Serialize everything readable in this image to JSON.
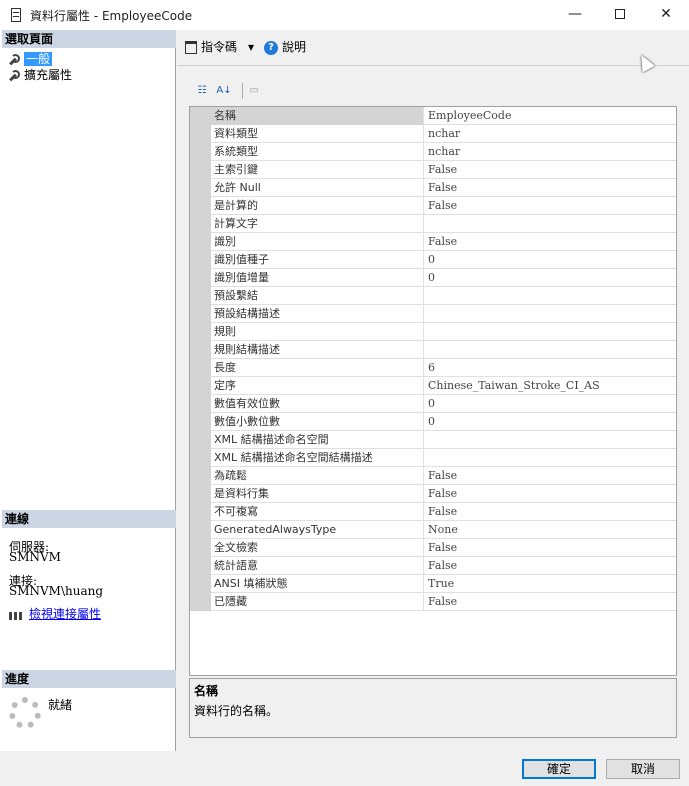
{
  "window": {
    "title": "資料行屬性 - EmployeeCode",
    "minimize": "—",
    "close": "✕"
  },
  "left": {
    "pages_header": "選取頁面",
    "pages": [
      "一般",
      "擴充屬性"
    ],
    "connection_header": "連線",
    "server_label": "伺服器:",
    "server_value": "SMNVM",
    "connection_label": "連接:",
    "connection_value": "SMNVM\\huang",
    "view_conn_link": "檢視連接屬性",
    "progress_header": "進度",
    "progress_status": "就緒"
  },
  "toolbar": {
    "script_label": "指令碼",
    "help_label": "說明",
    "dropdown_glyph": "▾"
  },
  "properties": [
    {
      "name": "名稱",
      "value": "EmployeeCode"
    },
    {
      "name": "資料類型",
      "value": "nchar"
    },
    {
      "name": "系統類型",
      "value": "nchar"
    },
    {
      "name": "主索引鍵",
      "value": "False"
    },
    {
      "name": "允許 Null",
      "value": "False"
    },
    {
      "name": "是計算的",
      "value": "False"
    },
    {
      "name": "計算文字",
      "value": ""
    },
    {
      "name": "識別",
      "value": "False"
    },
    {
      "name": "識別值種子",
      "value": "0"
    },
    {
      "name": "識別值增量",
      "value": "0"
    },
    {
      "name": "預設繫結",
      "value": ""
    },
    {
      "name": "預設結構描述",
      "value": ""
    },
    {
      "name": "規則",
      "value": ""
    },
    {
      "name": "規則結構描述",
      "value": ""
    },
    {
      "name": "長度",
      "value": "6"
    },
    {
      "name": "定序",
      "value": "Chinese_Taiwan_Stroke_CI_AS"
    },
    {
      "name": "數值有效位數",
      "value": "0"
    },
    {
      "name": "數值小數位數",
      "value": "0"
    },
    {
      "name": "XML 結構描述命名空間",
      "value": ""
    },
    {
      "name": "XML 結構描述命名空間結構描述",
      "value": ""
    },
    {
      "name": "為疏鬆",
      "value": "False"
    },
    {
      "name": "是資料行集",
      "value": "False"
    },
    {
      "name": "不可複寫",
      "value": "False"
    },
    {
      "name": "GeneratedAlwaysType",
      "value": "None"
    },
    {
      "name": "全文檢索",
      "value": "False"
    },
    {
      "name": "統計語意",
      "value": "False"
    },
    {
      "name": "ANSI 填補狀態",
      "value": "True"
    },
    {
      "name": "已隱藏",
      "value": "False"
    }
  ],
  "description": {
    "title": "名稱",
    "text": "資料行的名稱。"
  },
  "buttons": {
    "ok": "確定",
    "cancel": "取消"
  },
  "colors": {
    "section_header": "#ccd5e3",
    "selection": "#3399ff",
    "link": "#0000ee",
    "default_button_border": "#0078d7"
  }
}
